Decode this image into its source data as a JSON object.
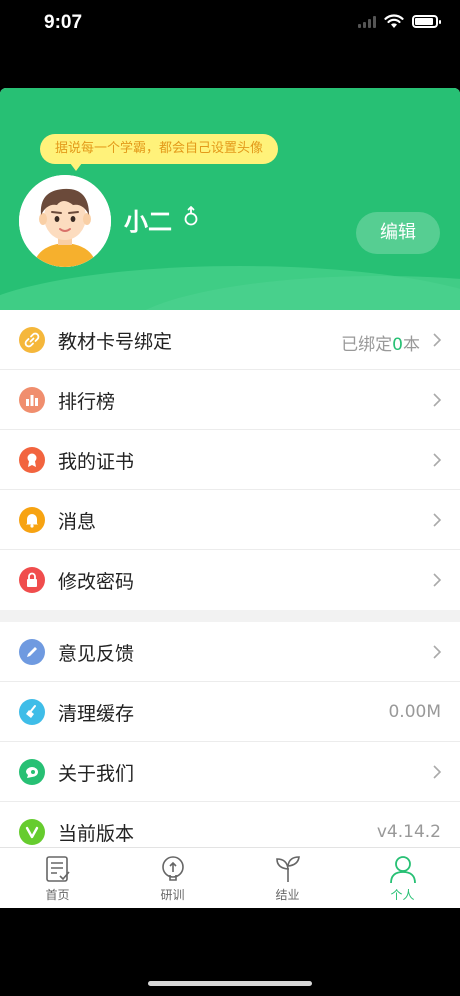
{
  "status_bar": {
    "time": "9:07"
  },
  "header": {
    "tip": "据说每一个学霸，都会自己设置头像",
    "username": "小二",
    "edit_label": "编辑"
  },
  "menu_group_1": [
    {
      "label": "教材卡号绑定",
      "value_prefix": "已绑定",
      "value_count": "0",
      "value_suffix": "本",
      "icon": "link-icon",
      "color": "#f5b73b"
    },
    {
      "label": "排行榜",
      "icon": "bar-chart-icon",
      "color": "#f08e6e"
    },
    {
      "label": "我的证书",
      "icon": "certificate-icon",
      "color": "#f2643f"
    },
    {
      "label": "消息",
      "icon": "bell-icon",
      "color": "#f7a312"
    },
    {
      "label": "修改密码",
      "icon": "lock-icon",
      "color": "#f04d4d"
    }
  ],
  "menu_group_2": [
    {
      "label": "意见反馈",
      "icon": "pencil-icon",
      "color": "#6f9ae0"
    },
    {
      "label": "清理缓存",
      "value": "0.00M",
      "icon": "broom-icon",
      "color": "#3fbde8"
    },
    {
      "label": "关于我们",
      "icon": "about-icon",
      "color": "#27c074"
    },
    {
      "label": "当前版本",
      "value": "v4.14.2",
      "icon": "version-icon",
      "color": "#66cc2e"
    }
  ],
  "tabs": [
    {
      "label": "首页",
      "icon": "home-list-icon",
      "active": false
    },
    {
      "label": "研训",
      "icon": "bulb-icon",
      "active": false
    },
    {
      "label": "结业",
      "icon": "sprout-icon",
      "active": false
    },
    {
      "label": "个人",
      "icon": "person-icon",
      "active": true
    }
  ],
  "colors": {
    "brand": "#27c074",
    "tip_bg": "#fff27a",
    "tip_text": "#e39a1a"
  }
}
